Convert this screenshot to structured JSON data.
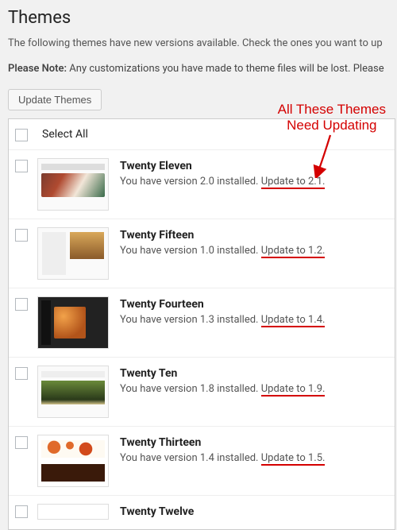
{
  "heading": "Themes",
  "intro": "The following themes have new versions available. Check the ones you want to up",
  "note_label": "Please Note:",
  "note_text": " Any customizations you have made to theme files will be lost. Please",
  "update_btn": "Update Themes",
  "select_all": "Select All",
  "annotation": {
    "line1": "All These Themes",
    "line2": "Need Updating"
  },
  "themes": [
    {
      "name": "Twenty Eleven",
      "installed": "You have version 2.0 installed. ",
      "update": "Update to 2.1."
    },
    {
      "name": "Twenty Fifteen",
      "installed": "You have version 1.0 installed. ",
      "update": "Update to 1.2."
    },
    {
      "name": "Twenty Fourteen",
      "installed": "You have version 1.3 installed. ",
      "update": "Update to 1.4."
    },
    {
      "name": "Twenty Ten",
      "installed": "You have version 1.8 installed. ",
      "update": "Update to 1.9."
    },
    {
      "name": "Twenty Thirteen",
      "installed": "You have version 1.4 installed. ",
      "update": "Update to 1.5."
    },
    {
      "name": "Twenty Twelve",
      "installed": "",
      "update": ""
    }
  ]
}
